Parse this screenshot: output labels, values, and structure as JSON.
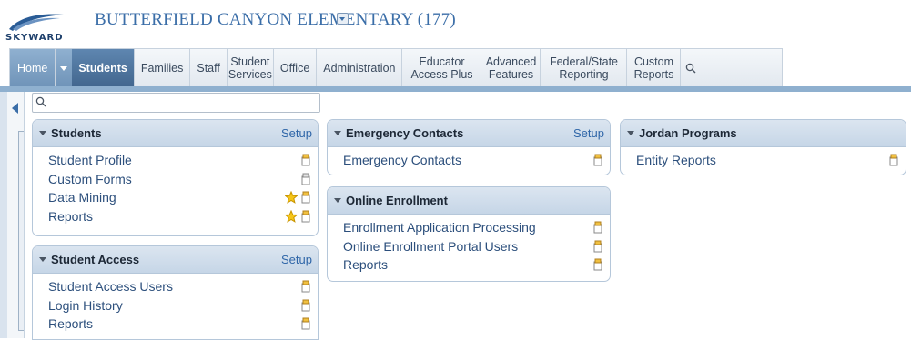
{
  "app": {
    "logo_text": "SKYWARD",
    "school": "BUTTERFIELD CANYON ELEMENTARY (177)"
  },
  "nav": {
    "home": "Home",
    "items": [
      {
        "label": "Students",
        "active": true
      },
      {
        "label": "Families"
      },
      {
        "label": "Staff"
      },
      {
        "label": "Student Services"
      },
      {
        "label": "Office"
      },
      {
        "label": "Administration"
      },
      {
        "label": "Educator Access Plus"
      },
      {
        "label": "Advanced Features"
      },
      {
        "label": "Federal/State Reporting"
      },
      {
        "label": "Custom Reports"
      }
    ]
  },
  "search": {
    "value": "",
    "placeholder": ""
  },
  "cards": {
    "students": {
      "title": "Students",
      "setup": "Setup",
      "items": [
        {
          "label": "Student Profile",
          "favorite": false
        },
        {
          "label": "Custom Forms",
          "favorite": false
        },
        {
          "label": "Data Mining",
          "favorite": true
        },
        {
          "label": "Reports",
          "favorite": true
        }
      ]
    },
    "student_access": {
      "title": "Student Access",
      "setup": "Setup",
      "items": [
        {
          "label": "Student Access Users"
        },
        {
          "label": "Login History"
        },
        {
          "label": "Reports"
        }
      ]
    },
    "emergency_contacts": {
      "title": "Emergency Contacts",
      "setup": "Setup",
      "items": [
        {
          "label": "Emergency Contacts"
        }
      ]
    },
    "online_enrollment": {
      "title": "Online Enrollment",
      "items": [
        {
          "label": "Enrollment Application Processing"
        },
        {
          "label": "Online Enrollment Portal Users"
        },
        {
          "label": "Reports"
        }
      ]
    },
    "jordan_programs": {
      "title": "Jordan Programs",
      "items": [
        {
          "label": "Entity Reports"
        }
      ]
    }
  },
  "colors": {
    "accent": "#42668e",
    "link": "#2c4f7c",
    "header_blue": "#3b6ea8"
  }
}
